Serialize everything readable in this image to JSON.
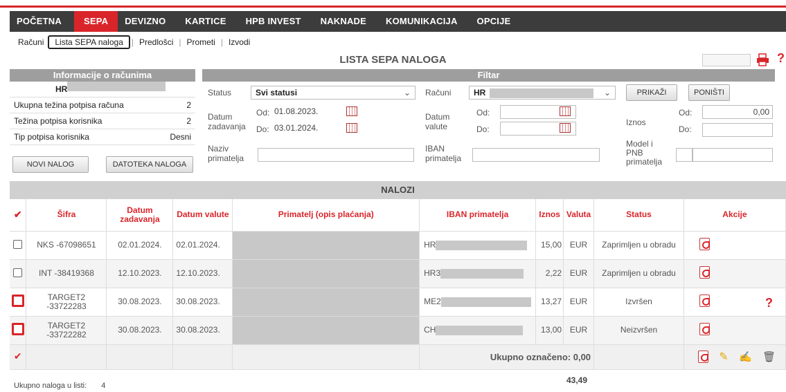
{
  "nav": {
    "items": [
      "POČETNA",
      "SEPA",
      "DEVIZNO",
      "KARTICE",
      "HPB INVEST",
      "NAKNADE",
      "KOMUNIKACIJA",
      "OPCIJE"
    ],
    "active": "SEPA"
  },
  "subnav": {
    "items": [
      "Računi",
      "Lista SEPA naloga",
      "Predlošci",
      "Prometi",
      "Izvodi"
    ],
    "active": "Lista SEPA naloga"
  },
  "page_title": "LISTA SEPA NALOGA",
  "info": {
    "header": "Informacije o računima",
    "account_prefix": "HR",
    "rows": [
      {
        "label": "Ukupna težina potpisa računa",
        "value": "2"
      },
      {
        "label": "Težina potpisa korisnika",
        "value": "2"
      },
      {
        "label": "Tip potpisa korisnika",
        "value": "Desni"
      }
    ],
    "new_order_button": "NOVI NALOG",
    "file_button": "DATOTEKA NALOGA"
  },
  "filter": {
    "header": "Filtar",
    "status_label": "Status",
    "status_value": "Svi statusi",
    "accounts_label": "Računi",
    "accounts_value": "HR",
    "show_button": "PRIKAŽI",
    "reset_button": "PONIŠTI",
    "entry_date_label": "Datum zadavanja",
    "from_label": "Od:",
    "to_label": "Do:",
    "entry_from": "01.08.2023.",
    "entry_to": "03.01.2024.",
    "value_date_label": "Datum valute",
    "amount_label": "Iznos",
    "amount_from": "0,00",
    "recipient_name_label": "Naziv primatelja",
    "iban_label": "IBAN primatelja",
    "model_label": "Model i PNB primatelja"
  },
  "orders": {
    "header": "NALOZI",
    "columns": [
      "Šifra",
      "Datum zadavanja",
      "Datum valute",
      "Primatelj (opis plaćanja)",
      "IBAN primatelja",
      "Iznos",
      "Valuta",
      "Status",
      "Akcije"
    ],
    "rows": [
      {
        "code": "NKS -67098651",
        "entry": "02.01.2024.",
        "value": "02.01.2024.",
        "iban": "HR",
        "amount": "15,00",
        "currency": "EUR",
        "status": "Zaprimljen u obradu"
      },
      {
        "code": "INT -38419368",
        "entry": "12.10.2023.",
        "value": "12.10.2023.",
        "iban": "HR3",
        "amount": "2,22",
        "currency": "EUR",
        "status": "Zaprimljen u obradu"
      },
      {
        "code": "TARGET2 -33722283",
        "entry": "30.08.2023.",
        "value": "30.08.2023.",
        "iban": "ME2",
        "amount": "13,27",
        "currency": "EUR",
        "status": "Izvršen"
      },
      {
        "code": "TARGET2 -33722282",
        "entry": "30.08.2023.",
        "value": "30.08.2023.",
        "iban": "CH",
        "amount": "13,00",
        "currency": "EUR",
        "status": "Neizvršen"
      }
    ],
    "total_marked_label": "Ukupno označeno: 0,00",
    "grand_total": "43,49",
    "count_label": "Ukupno naloga u listi:",
    "count_value": "4"
  },
  "help_glyph": "?"
}
